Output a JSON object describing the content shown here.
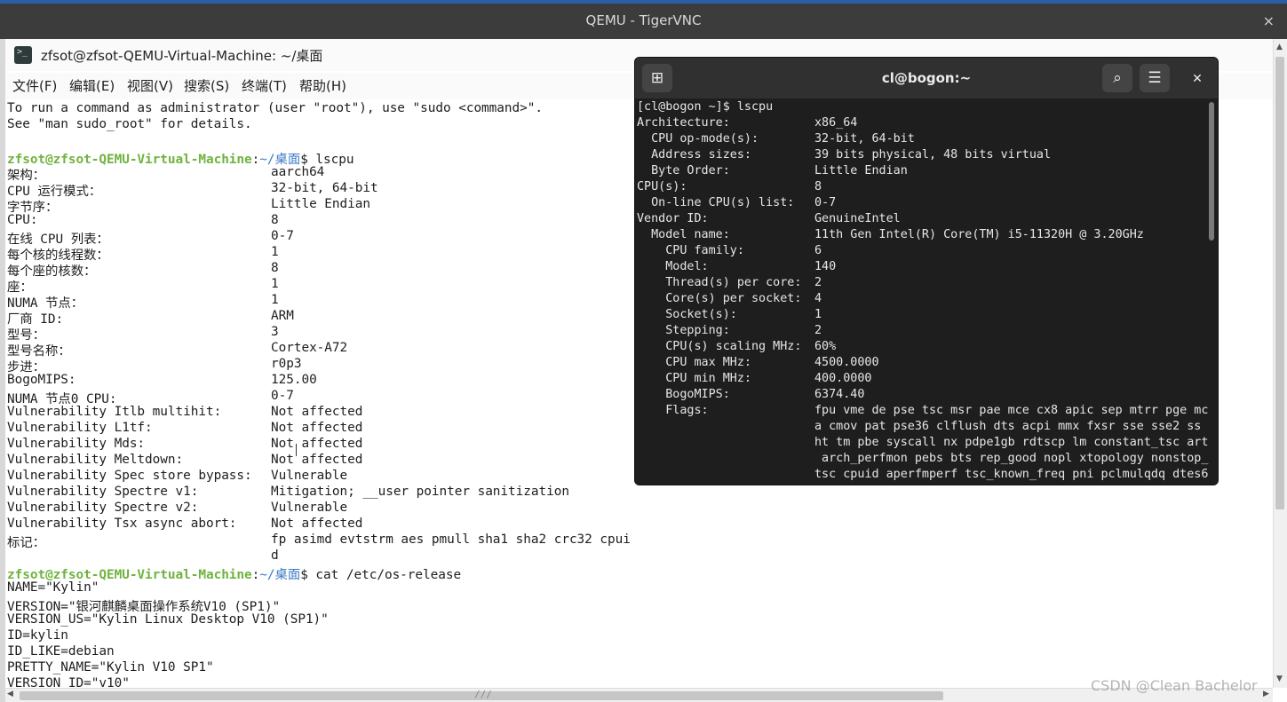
{
  "vnc": {
    "title": "QEMU - TigerVNC",
    "close": "×"
  },
  "kylin_terminal": {
    "title": "zfsot@zfsot-QEMU-Virtual-Machine: ~/桌面",
    "menu": [
      "文件(F)",
      "编辑(E)",
      "视图(V)",
      "搜索(S)",
      "终端(T)",
      "帮助(H)"
    ],
    "lines": [
      {
        "type": "text",
        "text": "To run a command as administrator (user \"root\"), use \"sudo <command>\"."
      },
      {
        "type": "text",
        "text": "See \"man sudo_root\" for details."
      },
      {
        "type": "text",
        "text": ""
      },
      {
        "type": "prompt",
        "user": "zfsot@zfsot-QEMU-Virtual-Machine",
        "path": "~/桌面",
        "cmd": "$ lscpu"
      },
      {
        "type": "kv",
        "k": "架构：",
        "v": "aarch64"
      },
      {
        "type": "kv",
        "k": "CPU 运行模式：",
        "v": "32-bit, 64-bit"
      },
      {
        "type": "kv",
        "k": "字节序：",
        "v": "Little Endian"
      },
      {
        "type": "kv",
        "k": "CPU:",
        "v": "8"
      },
      {
        "type": "kv",
        "k": "在线 CPU 列表：",
        "v": "0-7"
      },
      {
        "type": "kv",
        "k": "每个核的线程数：",
        "v": "1"
      },
      {
        "type": "kv",
        "k": "每个座的核数：",
        "v": "8"
      },
      {
        "type": "kv",
        "k": "座：",
        "v": "1"
      },
      {
        "type": "kv",
        "k": "NUMA 节点：",
        "v": "1"
      },
      {
        "type": "kv",
        "k": "厂商 ID:",
        "v": "ARM"
      },
      {
        "type": "kv",
        "k": "型号：",
        "v": "3"
      },
      {
        "type": "kv",
        "k": "型号名称：",
        "v": "Cortex-A72"
      },
      {
        "type": "kv",
        "k": "步进：",
        "v": "r0p3"
      },
      {
        "type": "kv",
        "k": "BogoMIPS:",
        "v": "125.00"
      },
      {
        "type": "kv",
        "k": "NUMA 节点0 CPU:",
        "v": "0-7"
      },
      {
        "type": "kv",
        "k": "Vulnerability Itlb multihit:",
        "v": "Not affected"
      },
      {
        "type": "kv",
        "k": "Vulnerability L1tf:",
        "v": "Not affected"
      },
      {
        "type": "kv",
        "k": "Vulnerability Mds:",
        "v": "Not affected"
      },
      {
        "type": "kv",
        "k": "Vulnerability Meltdown:",
        "v": "Not affected"
      },
      {
        "type": "kv",
        "k": "Vulnerability Spec store bypass:",
        "v": "Vulnerable"
      },
      {
        "type": "kv",
        "k": "Vulnerability Spectre v1:",
        "v": "Mitigation; __user pointer sanitization"
      },
      {
        "type": "kv",
        "k": "Vulnerability Spectre v2:",
        "v": "Vulnerable"
      },
      {
        "type": "kv",
        "k": "Vulnerability Tsx async abort:",
        "v": "Not affected"
      },
      {
        "type": "kv",
        "k": "标记：",
        "v": "fp asimd evtstrm aes pmull sha1 sha2 crc32 cpui"
      },
      {
        "type": "kv",
        "k": "",
        "v": "d"
      },
      {
        "type": "prompt",
        "user": "zfsot@zfsot-QEMU-Virtual-Machine",
        "path": "~/桌面",
        "cmd": "$ cat /etc/os-release"
      },
      {
        "type": "text",
        "text": "NAME=\"Kylin\""
      },
      {
        "type": "text",
        "text": "VERSION=\"银河麒麟桌面操作系统V10 (SP1)\""
      },
      {
        "type": "text",
        "text": "VERSION_US=\"Kylin Linux Desktop V10 (SP1)\""
      },
      {
        "type": "text",
        "text": "ID=kylin"
      },
      {
        "type": "text",
        "text": "ID_LIKE=debian"
      },
      {
        "type": "text",
        "text": "PRETTY_NAME=\"Kylin V10 SP1\""
      },
      {
        "type": "text",
        "text": "VERSION_ID=\"v10\""
      }
    ]
  },
  "gnome_terminal": {
    "title": "cl@bogon:~",
    "new_tab_icon": "⊞",
    "search_icon": "⌕",
    "menu_icon": "☰",
    "close_icon": "✕",
    "lines": [
      {
        "k": "[cl@bogon ~]$ lscpu",
        "v": ""
      },
      {
        "k": "Architecture:",
        "v": "x86_64"
      },
      {
        "k": "  CPU op-mode(s):",
        "v": "32-bit, 64-bit"
      },
      {
        "k": "  Address sizes:",
        "v": "39 bits physical, 48 bits virtual"
      },
      {
        "k": "  Byte Order:",
        "v": "Little Endian"
      },
      {
        "k": "CPU(s):",
        "v": "8"
      },
      {
        "k": "  On-line CPU(s) list:",
        "v": "0-7"
      },
      {
        "k": "Vendor ID:",
        "v": "GenuineIntel"
      },
      {
        "k": "  Model name:",
        "v": "11th Gen Intel(R) Core(TM) i5-11320H @ 3.20GHz"
      },
      {
        "k": "    CPU family:",
        "v": "6"
      },
      {
        "k": "    Model:",
        "v": "140"
      },
      {
        "k": "    Thread(s) per core:",
        "v": "2"
      },
      {
        "k": "    Core(s) per socket:",
        "v": "4"
      },
      {
        "k": "    Socket(s):",
        "v": "1"
      },
      {
        "k": "    Stepping:",
        "v": "2"
      },
      {
        "k": "    CPU(s) scaling MHz:",
        "v": "60%"
      },
      {
        "k": "    CPU max MHz:",
        "v": "4500.0000"
      },
      {
        "k": "    CPU min MHz:",
        "v": "400.0000"
      },
      {
        "k": "    BogoMIPS:",
        "v": "6374.40"
      },
      {
        "k": "    Flags:",
        "v": "fpu vme de pse tsc msr pae mce cx8 apic sep mtrr pge mc"
      },
      {
        "k": "",
        "v": "a cmov pat pse36 clflush dts acpi mmx fxsr sse sse2 ss"
      },
      {
        "k": "",
        "v": "ht tm pbe syscall nx pdpe1gb rdtscp lm constant_tsc art"
      },
      {
        "k": "",
        "v": " arch_perfmon pebs bts rep_good nopl xtopology nonstop_"
      },
      {
        "k": "",
        "v": "tsc cpuid aperfmperf tsc_known_freq pni pclmulqdq dtes6"
      }
    ]
  },
  "watermark": "CSDN @Clean Bachelor"
}
